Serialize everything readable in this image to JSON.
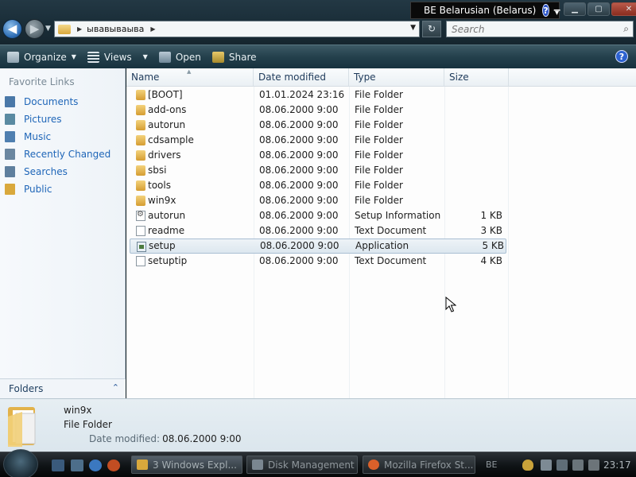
{
  "language_bar": {
    "label": "BE Belarusian (Belarus)",
    "help_glyph": "?"
  },
  "window_buttons": {
    "minimize": "▁",
    "maximize": "▢",
    "close": "✕"
  },
  "nav": {
    "back_glyph": "◀",
    "forward_glyph": "▶",
    "history_glyph": "▼"
  },
  "address": {
    "chevron": "▶",
    "path": "ывавываыва",
    "drop": "▼",
    "end_chevron": "▶"
  },
  "refresh_glyph": "↻",
  "search": {
    "placeholder": "Search",
    "icon": "⌕"
  },
  "toolbar": {
    "organize": "Organize",
    "views": "Views",
    "open": "Open",
    "share": "Share",
    "arrow": "▼",
    "help": "?"
  },
  "favorites": {
    "header": "Favorite Links",
    "items": [
      {
        "label": "Documents",
        "icon": "documents-icon",
        "color": "#4a78a8"
      },
      {
        "label": "Pictures",
        "icon": "pictures-icon",
        "color": "#5a8aa2"
      },
      {
        "label": "Music",
        "icon": "music-icon",
        "color": "#4f7fb0"
      },
      {
        "label": "Recently Changed",
        "icon": "recently-changed-icon",
        "color": "#6a86a0"
      },
      {
        "label": "Searches",
        "icon": "searches-icon",
        "color": "#5f7f9e"
      },
      {
        "label": "Public",
        "icon": "public-folder-icon",
        "color": "#d9a83c"
      }
    ]
  },
  "folders_bar": {
    "label": "Folders",
    "chevron": "⌃"
  },
  "columns": {
    "name": "Name",
    "date": "Date modified",
    "type": "Type",
    "size": "Size",
    "sort_glyph": "▲"
  },
  "files": [
    {
      "name": "[BOOT]",
      "date": "01.01.2024 23:16",
      "type": "File Folder",
      "size": "",
      "icon": "folder"
    },
    {
      "name": "add-ons",
      "date": "08.06.2000 9:00",
      "type": "File Folder",
      "size": "",
      "icon": "folder"
    },
    {
      "name": "autorun",
      "date": "08.06.2000 9:00",
      "type": "File Folder",
      "size": "",
      "icon": "folder"
    },
    {
      "name": "cdsample",
      "date": "08.06.2000 9:00",
      "type": "File Folder",
      "size": "",
      "icon": "folder"
    },
    {
      "name": "drivers",
      "date": "08.06.2000 9:00",
      "type": "File Folder",
      "size": "",
      "icon": "folder"
    },
    {
      "name": "sbsi",
      "date": "08.06.2000 9:00",
      "type": "File Folder",
      "size": "",
      "icon": "folder"
    },
    {
      "name": "tools",
      "date": "08.06.2000 9:00",
      "type": "File Folder",
      "size": "",
      "icon": "folder"
    },
    {
      "name": "win9x",
      "date": "08.06.2000 9:00",
      "type": "File Folder",
      "size": "",
      "icon": "folder"
    },
    {
      "name": "autorun",
      "date": "08.06.2000 9:00",
      "type": "Setup Information",
      "size": "1 KB",
      "icon": "inf"
    },
    {
      "name": "readme",
      "date": "08.06.2000 9:00",
      "type": "Text Document",
      "size": "3 KB",
      "icon": "doc"
    },
    {
      "name": "setup",
      "date": "08.06.2000 9:00",
      "type": "Application",
      "size": "5 KB",
      "icon": "app",
      "selected": true
    },
    {
      "name": "setuptip",
      "date": "08.06.2000 9:00",
      "type": "Text Document",
      "size": "4 KB",
      "icon": "doc"
    }
  ],
  "details": {
    "name": "win9x",
    "type": "File Folder",
    "date_label": "Date modified:",
    "date_value": "08.06.2000 9:00"
  },
  "taskbar": {
    "buttons": [
      {
        "label": "3 Windows Expl...",
        "icon": "explorer-folder-icon",
        "color": "#d9a83c",
        "active": true
      },
      {
        "label": "Disk Management",
        "icon": "disk-management-icon",
        "color": "#7a8690",
        "active": false
      },
      {
        "label": "Mozilla Firefox St...",
        "icon": "firefox-icon",
        "color": "#d9602a",
        "active": false
      }
    ],
    "tray_lang": "BE",
    "clock": "23:17"
  }
}
